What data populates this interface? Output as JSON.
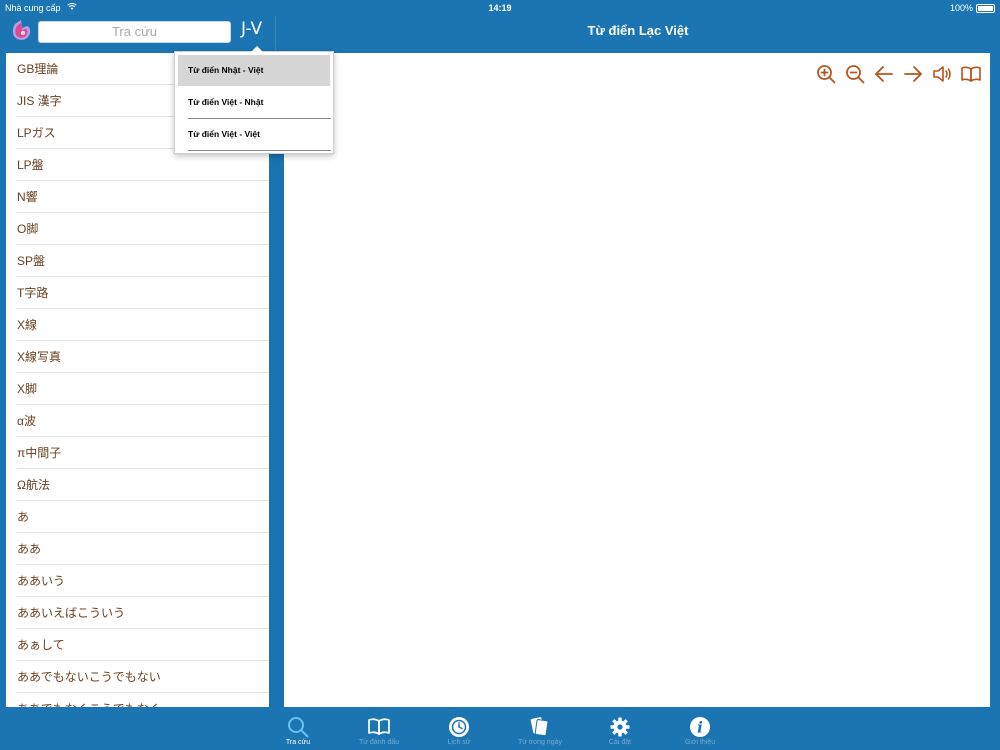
{
  "status_bar": {
    "carrier": "Nhà cung cấp",
    "time": "14:19",
    "battery": "100%"
  },
  "header": {
    "search_placeholder": "Tra cứu",
    "lang_toggle": "J-V",
    "title": "Từ điển Lạc Việt"
  },
  "dropdown": {
    "items": [
      {
        "label": "Từ điển Nhật - Việt",
        "selected": true
      },
      {
        "label": "Từ điển Việt - Nhật",
        "selected": false
      },
      {
        "label": "Từ điển Việt - Việt",
        "selected": false
      }
    ]
  },
  "word_list": [
    "GB理論",
    "JIS 漢字",
    "LPガス",
    "LP盤",
    "N響",
    "O脚",
    "SP盤",
    "T字路",
    "X線",
    "X線写真",
    "X脚",
    "α波",
    "π中間子",
    "Ω航法",
    "あ",
    "ああ",
    "ああいう",
    "ああいえばこういう",
    "あぁして",
    "ああでもないこうでもない",
    "ああでもなくこうでもなく"
  ],
  "toolbar": {
    "icons": [
      "zoom-in-icon",
      "zoom-out-icon",
      "arrow-left-icon",
      "arrow-right-icon",
      "speaker-icon",
      "book-icon"
    ],
    "color": "#b8541d"
  },
  "tabs": [
    {
      "label": "Tra cứu",
      "icon": "search-icon",
      "active": true
    },
    {
      "label": "Từ đánh dấu",
      "icon": "book-icon",
      "active": false
    },
    {
      "label": "Lịch sử",
      "icon": "history-icon",
      "active": false
    },
    {
      "label": "Từ trong ngày",
      "icon": "cards-icon",
      "active": false
    },
    {
      "label": "Cài đặt",
      "icon": "gear-icon",
      "active": false
    },
    {
      "label": "Giới thiệu",
      "icon": "info-icon",
      "active": false
    }
  ],
  "colors": {
    "accent": "#1b75b3",
    "word_text": "#6b4020",
    "tab_inactive": "#7aaad0",
    "tab_active": "#ffffff"
  }
}
